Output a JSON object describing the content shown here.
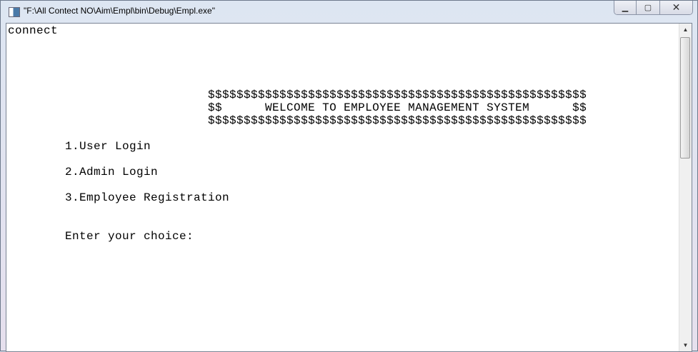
{
  "window": {
    "title": "\"F:\\All Contect NO\\Aim\\Empl\\bin\\Debug\\Empl.exe\"",
    "minimize": "▁",
    "maximize": "▢",
    "close": "✕"
  },
  "console": {
    "lines": [
      "connect",
      "",
      "",
      "",
      "",
      "                            $$$$$$$$$$$$$$$$$$$$$$$$$$$$$$$$$$$$$$$$$$$$$$$$$$$$$",
      "                            $$      WELCOME TO EMPLOYEE MANAGEMENT SYSTEM      $$",
      "                            $$$$$$$$$$$$$$$$$$$$$$$$$$$$$$$$$$$$$$$$$$$$$$$$$$$$$",
      "",
      "        1.User Login",
      "",
      "        2.Admin Login",
      "",
      "        3.Employee Registration",
      "",
      "",
      "        Enter your choice:"
    ]
  },
  "scrollbar": {
    "up": "▲",
    "down": "▼"
  }
}
